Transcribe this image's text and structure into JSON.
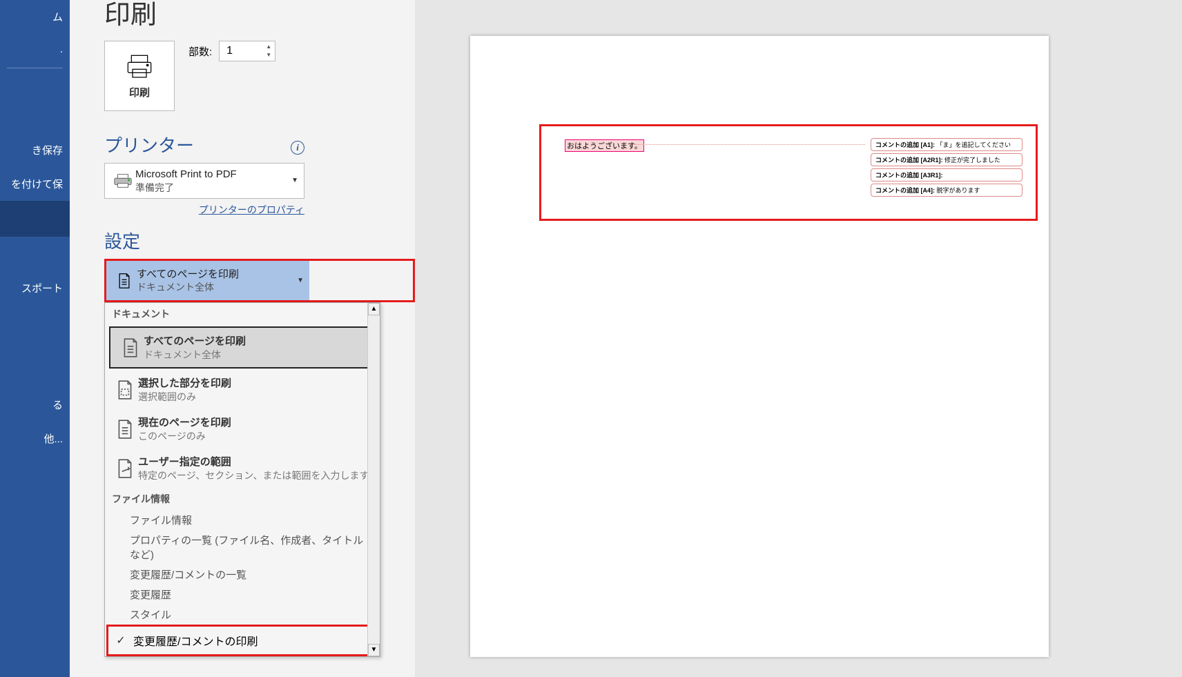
{
  "sidebar": {
    "items": [
      "ム",
      ".",
      "き保存",
      "を付けて保",
      "",
      "スポート",
      "る",
      "他..."
    ]
  },
  "page_title": "印刷",
  "print_button": {
    "label": "印刷"
  },
  "copies": {
    "label": "部数:",
    "value": "1"
  },
  "printer": {
    "heading": "プリンター",
    "name": "Microsoft Print to PDF",
    "status": "準備完了",
    "props_link": "プリンターのプロパティ"
  },
  "settings": {
    "heading": "設定",
    "selected": {
      "title": "すべてのページを印刷",
      "sub": "ドキュメント全体"
    }
  },
  "dropdown": {
    "sec_doc": "ドキュメント",
    "items": [
      {
        "title": "すべてのページを印刷",
        "sub": "ドキュメント全体"
      },
      {
        "title": "選択した部分を印刷",
        "sub": "選択範囲のみ"
      },
      {
        "title": "現在のページを印刷",
        "sub": "このページのみ"
      },
      {
        "title": "ユーザー指定の範囲",
        "sub": "特定のページ、セクション、または範囲を入力します"
      }
    ],
    "sec_file": "ファイル情報",
    "subs": [
      "ファイル情報",
      "プロパティの一覧 (ファイル名、作成者、タイトルなど)",
      "変更履歴/コメントの一覧",
      "変更履歴",
      "スタイル"
    ],
    "footer": "変更履歴/コメントの印刷"
  },
  "preview": {
    "doc_text": "おはようございます。",
    "comments": [
      {
        "label": "コメントの追加 [A1]:",
        "body": "「ま」を追記してください"
      },
      {
        "label": "コメントの追加 [A2R1]:",
        "body": "修正が完了しました"
      },
      {
        "label": "コメントの追加 [A3R1]:",
        "body": ""
      },
      {
        "label": "コメントの追加 [A4]:",
        "body": "脱字があります"
      }
    ]
  }
}
